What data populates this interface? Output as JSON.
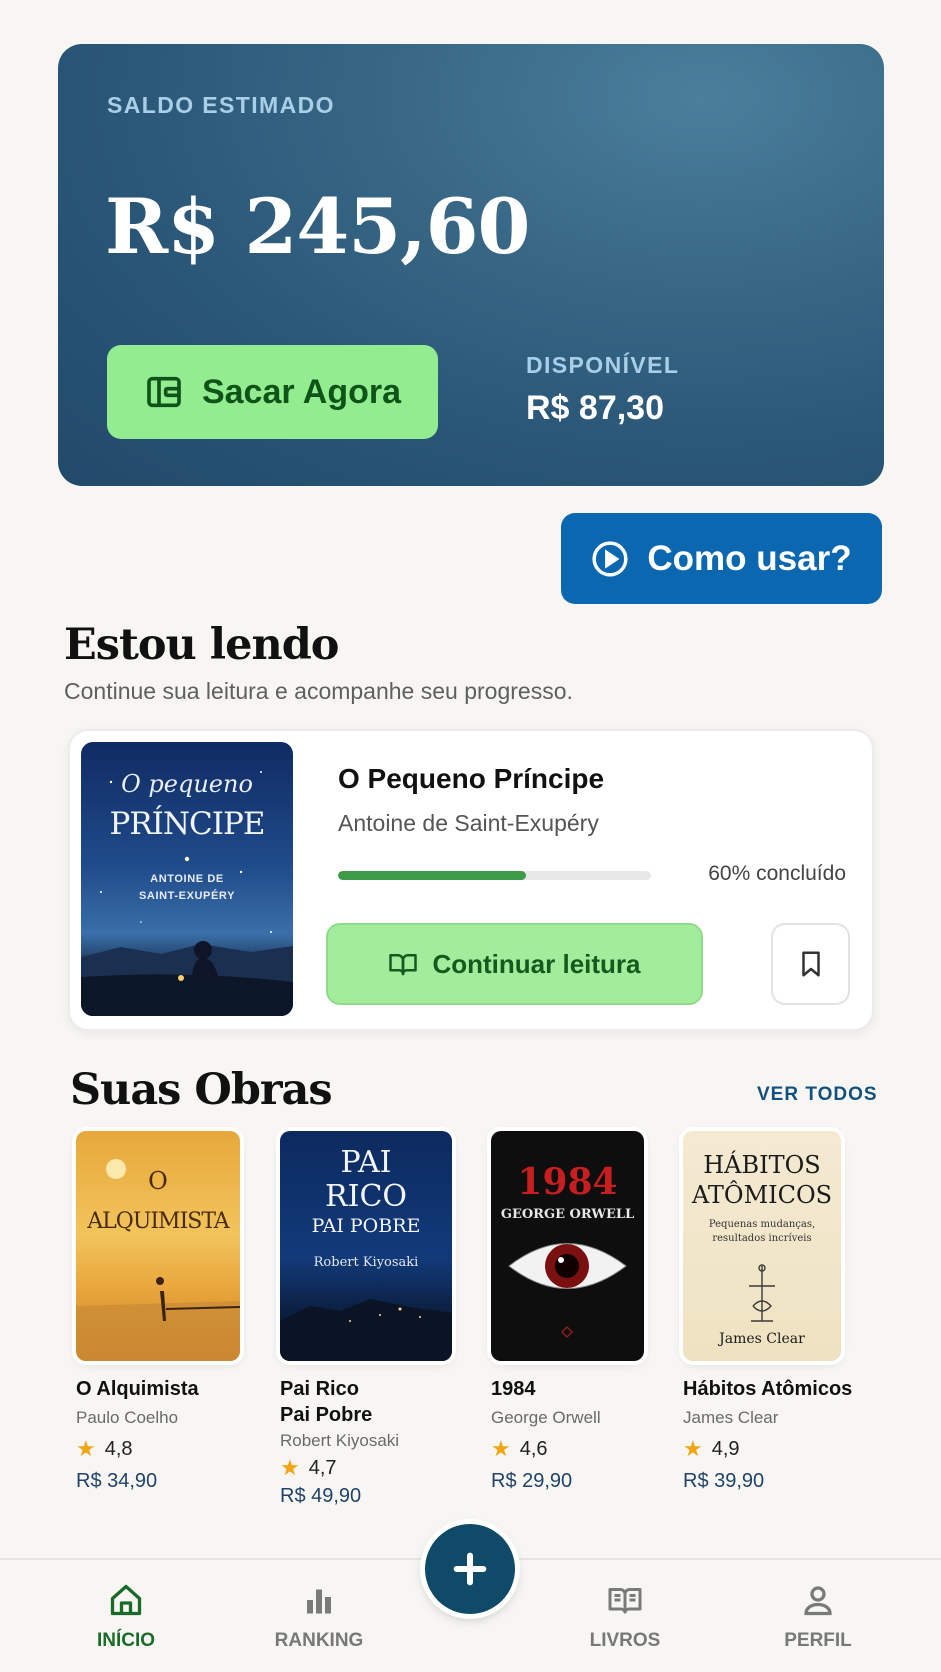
{
  "balance": {
    "label": "SALDO ESTIMADO",
    "value": "R$ 245,60",
    "withdraw_label": "Sacar Agora",
    "available_label": "DISPONÍVEL",
    "available_value": "R$ 87,30"
  },
  "howto": {
    "label": "Como usar?"
  },
  "reading": {
    "title": "Estou lendo",
    "subtitle": "Continue sua leitura e acompanhe seu progresso.",
    "book": {
      "title": "O Pequeno Príncipe",
      "author": "Antoine de Saint-Exupéry",
      "progress": 0.6,
      "progress_text": "60% concluído",
      "cover_line1": "O pequeno",
      "cover_line2": "PRÍNCIPE",
      "cover_author1": "ANTOINE DE",
      "cover_author2": "SAINT-EXUPÉRY"
    },
    "continue_label": "Continuar leitura"
  },
  "works": {
    "title": "Suas Obras",
    "see_all": "VER TODOS",
    "books": [
      {
        "title": "O Alquimista",
        "author": "Paulo Coelho",
        "rating": "4,8",
        "price": "R$ 34,90",
        "cover_lines": [
          "O",
          "ALQUIMISTA"
        ]
      },
      {
        "title_line1": "Pai Rico",
        "title_line2": "Pai Pobre",
        "author": "Robert Kiyosaki",
        "rating": "4,7",
        "price": "R$ 49,90",
        "cover_lines": [
          "PAI",
          "RICO",
          "PAI POBRE",
          "Robert Kiyosaki"
        ]
      },
      {
        "title": "1984",
        "author": "George Orwell",
        "rating": "4,6",
        "price": "R$ 29,90",
        "cover_lines": [
          "1984",
          "GEORGE ORWELL"
        ]
      },
      {
        "title": "Hábitos Atômicos",
        "author": "James Clear",
        "rating": "4,9",
        "price": "R$ 39,90",
        "cover_lines": [
          "HÁBITOS",
          "ATÔMICOS",
          "Pequenas mudanças,",
          "resultados incríveis",
          "James Clear"
        ]
      }
    ]
  },
  "nav": {
    "items": [
      {
        "label": "INÍCIO",
        "icon": "home-icon",
        "active": true
      },
      {
        "label": "RANKING",
        "icon": "bar-chart-icon"
      },
      {
        "label": "LIVROS",
        "icon": "book-open-icon"
      },
      {
        "label": "PERFIL",
        "icon": "user-icon"
      }
    ],
    "fab_icon": "plus-icon"
  },
  "colors": {
    "accent_green": "#93ec8f",
    "primary_blue": "#0b67b0",
    "card_blue": "#2a5677",
    "nav_active": "#1a6b2a"
  }
}
